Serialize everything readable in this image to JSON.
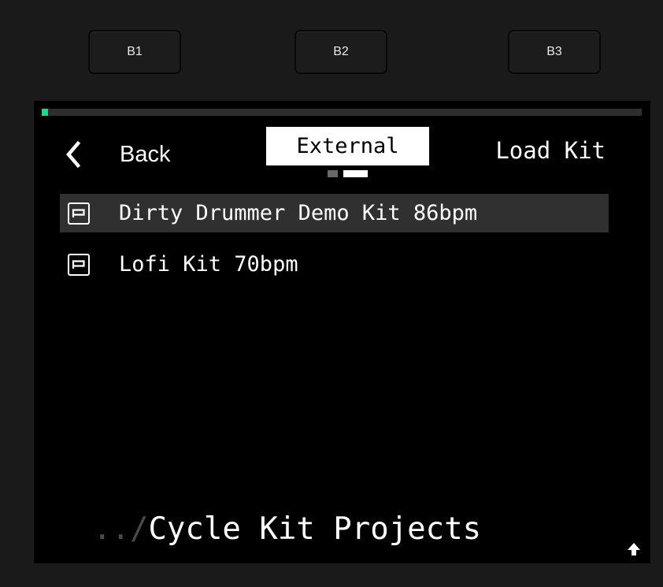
{
  "hardware_buttons": [
    {
      "label": "B1"
    },
    {
      "label": "B2"
    },
    {
      "label": "B3"
    }
  ],
  "header": {
    "back_label": "Back",
    "tab_title": "External",
    "load_label": "Load Kit",
    "page_indicator": {
      "pages": 2,
      "current": 2
    }
  },
  "progress": {
    "value": 0.01,
    "color": "#19d98a"
  },
  "list": {
    "items": [
      {
        "label": "Dirty Drummer Demo Kit 86bpm",
        "selected": true,
        "icon": "project-icon"
      },
      {
        "label": "Lofi Kit 70bpm",
        "selected": false,
        "icon": "project-icon"
      }
    ]
  },
  "path": {
    "prefix": "../",
    "name": "Cycle Kit Projects"
  },
  "colors": {
    "accent": "#19d98a",
    "selection": "#303030",
    "screen_bg": "#000000"
  }
}
